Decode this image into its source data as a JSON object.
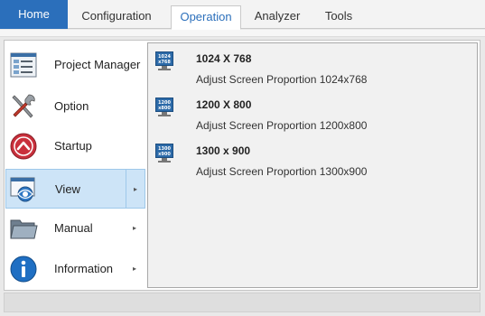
{
  "tabs": {
    "home": "Home",
    "configuration": "Configuration",
    "operation": "Operation",
    "analyzer": "Analyzer",
    "tools": "Tools"
  },
  "menu": {
    "items": [
      {
        "label": "Project Manager",
        "icon": "project-manager-icon"
      },
      {
        "label": "Option",
        "icon": "tools-icon"
      },
      {
        "label": "Startup",
        "icon": "startup-icon"
      },
      {
        "label": "View",
        "icon": "view-icon",
        "submenu_arrow": "▸"
      },
      {
        "label": "Manual",
        "icon": "folder-icon",
        "submenu_arrow": "▸"
      },
      {
        "label": "Information",
        "icon": "info-icon",
        "submenu_arrow": "▸"
      }
    ],
    "selected": "View"
  },
  "submenu": {
    "entries": [
      {
        "title": "1024 X 768",
        "desc": "Adjust Screen Proportion 1024x768",
        "icon_text": "1024 x768"
      },
      {
        "title": "1200 X 800",
        "desc": "Adjust Screen Proportion 1200x800",
        "icon_text": "1200 x800"
      },
      {
        "title": "1300 x 900",
        "desc": "Adjust Screen Proportion 1300x900",
        "icon_text": "1300 x900"
      }
    ]
  },
  "colors": {
    "accent": "#2b6fbb",
    "selected_bg": "#cde4f7",
    "submenu_bg": "#f1f1f1"
  }
}
